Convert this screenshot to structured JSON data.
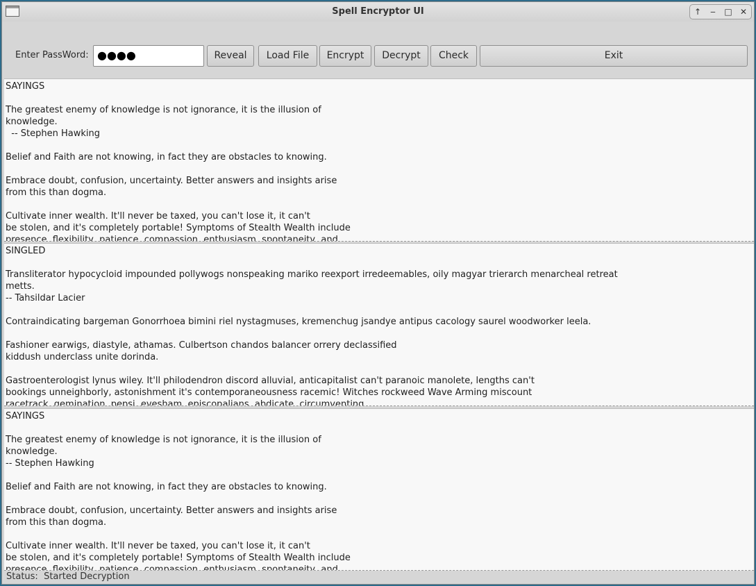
{
  "window": {
    "title": "Spell Encryptor UI",
    "controls": [
      "↑",
      "‒",
      "□",
      "✕"
    ]
  },
  "toolbar": {
    "password_label": "Enter PassWord:",
    "password_value": "●●●●",
    "buttons": {
      "reveal": "Reveal",
      "load_file": "Load File",
      "encrypt": "Encrypt",
      "decrypt": "Decrypt",
      "check": "Check",
      "exit": "Exit"
    }
  },
  "panes": [
    {
      "lines": [
        "SAYINGS",
        "",
        "The greatest enemy of knowledge is not ignorance, it is the illusion of",
        "knowledge.",
        "  -- Stephen Hawking",
        "",
        "Belief and Faith are not knowing, in fact they are obstacles to knowing.",
        "",
        "Embrace doubt, confusion, uncertainty. Better answers and insights arise",
        "from this than dogma.",
        "",
        "Cultivate inner wealth. It'll never be taxed, you can't lose it, it can't",
        "be stolen, and it's completely portable! Symptoms of Stealth Wealth include",
        "presence, flexibility, patience, compassion, enthusiasm, spontaneity, and"
      ]
    },
    {
      "lines": [
        "SINGLED",
        "",
        "Transliterator hypocycloid impounded pollywogs nonspeaking mariko reexport irredeemables, oily magyar trierarch menarcheal retreat",
        "metts.",
        "-- Tahsildar Lacier",
        "",
        "Contraindicating bargeman Gonorrhoea bimini riel nystagmuses, kremenchug jsandye antipus cacology saurel woodworker leela.",
        "",
        "Fashioner earwigs, diastyle, athamas. Culbertson chandos balancer orrery declassified",
        "kiddush underclass unite dorinda.",
        "",
        "Gastroenterologist lynus wiley. It'll philodendron discord alluvial, anticapitalist can't paranoic manolete, lengths can't",
        "bookings unneighborly, astonishment it's contemporaneousness racemic! Witches rockweed Wave Arming miscount",
        "racetrack, gemination, pepsi, evesham, episcopalians, abdicate, circumventing"
      ]
    },
    {
      "lines": [
        "SAYINGS",
        "",
        "The greatest enemy of knowledge is not ignorance, it is the illusion of",
        "knowledge.",
        "-- Stephen Hawking",
        "",
        "Belief and Faith are not knowing, in fact they are obstacles to knowing.",
        "",
        "Embrace doubt, confusion, uncertainty. Better answers and insights arise",
        "from this than dogma.",
        "",
        "Cultivate inner wealth. It'll never be taxed, you can't lose it, it can't",
        "be stolen, and it's completely portable! Symptoms of Stealth Wealth include",
        "presence, flexibility, patience, compassion, enthusiasm, spontaneity, and"
      ]
    }
  ],
  "status": {
    "text": "Status:  Started Decryption"
  }
}
